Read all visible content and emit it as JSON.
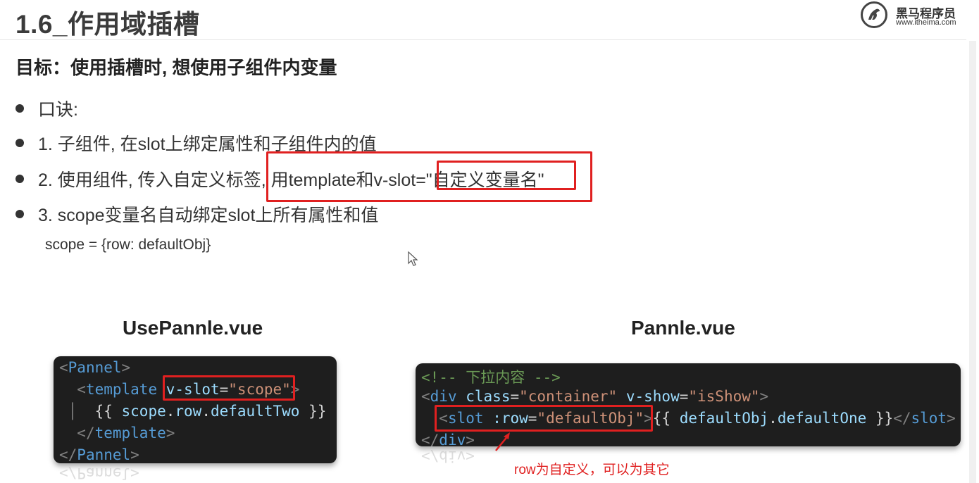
{
  "header": {
    "title": "1.6_作用域插槽",
    "logo_name": "黑马程序员",
    "logo_url": "www.itheima.com"
  },
  "goal": "目标：使用插槽时, 想使用子组件内变量",
  "bullets": [
    "口诀:",
    "1. 子组件, 在slot上绑定属性和子组件内的值",
    "2. 使用组件, 传入自定义标签, 用template和v-slot=\"自定义变量名\"",
    "3. scope变量名自动绑定slot上所有属性和值"
  ],
  "scope_note": "scope = {row: defaultObj}",
  "left_panel": {
    "heading": "UsePannle.vue",
    "lines": [
      "<Pannel>",
      "  <template v-slot=\"scope\">",
      "    {{ scope.row.defaultTwo }}",
      "  </template>",
      "</Pannel>"
    ]
  },
  "right_panel": {
    "heading": "Pannle.vue",
    "lines": [
      "<!-- 下拉内容 -->",
      "<div class=\"container\" v-show=\"isShow\">",
      "  <slot :row=\"defaultObj\">{{ defaultObj.defaultOne }}</slot>",
      "</div>"
    ]
  },
  "annotation": "row为自定义，可以为其它",
  "colors": {
    "highlight_red": "#e02020",
    "code_bg": "#1e1e1e",
    "tag_blue": "#569cd6",
    "attr_lightblue": "#9cdcfe",
    "string_orange": "#ce9178",
    "comment_green": "#6a9955"
  }
}
